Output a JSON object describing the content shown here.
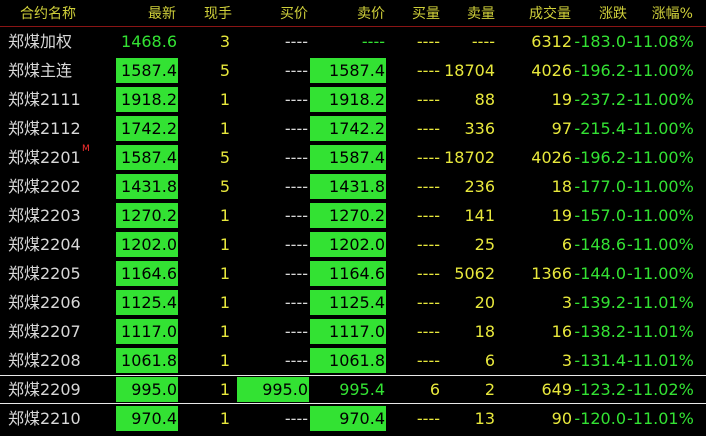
{
  "headers": {
    "name": "合约名称",
    "last": "最新",
    "cur_vol": "现手",
    "bid": "买价",
    "ask": "卖价",
    "bid_vol": "买量",
    "ask_vol": "卖量",
    "volume": "成交量",
    "change": "涨跌",
    "change_pct": "涨幅%"
  },
  "rows": [
    {
      "name": "郑煤加权",
      "mark": "",
      "last": "1468.6",
      "cur_vol": "3",
      "bid": "----",
      "ask": "----",
      "bid_vol": "----",
      "ask_vol": "----",
      "volume": "6312",
      "change": "-183.0",
      "change_pct": "-11.08%",
      "last_box": false,
      "bid_box": false,
      "ask_box": false,
      "selected": false
    },
    {
      "name": "郑煤主连",
      "mark": "",
      "last": "1587.4",
      "cur_vol": "5",
      "bid": "----",
      "ask": "1587.4",
      "bid_vol": "----",
      "ask_vol": "18704",
      "volume": "4026",
      "change": "-196.2",
      "change_pct": "-11.00%",
      "last_box": true,
      "bid_box": false,
      "ask_box": true,
      "selected": false
    },
    {
      "name": "郑煤2111",
      "mark": "",
      "last": "1918.2",
      "cur_vol": "1",
      "bid": "----",
      "ask": "1918.2",
      "bid_vol": "----",
      "ask_vol": "88",
      "volume": "19",
      "change": "-237.2",
      "change_pct": "-11.00%",
      "last_box": true,
      "bid_box": false,
      "ask_box": true,
      "selected": false
    },
    {
      "name": "郑煤2112",
      "mark": "",
      "last": "1742.2",
      "cur_vol": "1",
      "bid": "----",
      "ask": "1742.2",
      "bid_vol": "----",
      "ask_vol": "336",
      "volume": "97",
      "change": "-215.4",
      "change_pct": "-11.00%",
      "last_box": true,
      "bid_box": false,
      "ask_box": true,
      "selected": false
    },
    {
      "name": "郑煤2201",
      "mark": "M",
      "last": "1587.4",
      "cur_vol": "5",
      "bid": "----",
      "ask": "1587.4",
      "bid_vol": "----",
      "ask_vol": "18702",
      "volume": "4026",
      "change": "-196.2",
      "change_pct": "-11.00%",
      "last_box": true,
      "bid_box": false,
      "ask_box": true,
      "selected": false
    },
    {
      "name": "郑煤2202",
      "mark": "",
      "last": "1431.8",
      "cur_vol": "5",
      "bid": "----",
      "ask": "1431.8",
      "bid_vol": "----",
      "ask_vol": "236",
      "volume": "18",
      "change": "-177.0",
      "change_pct": "-11.00%",
      "last_box": true,
      "bid_box": false,
      "ask_box": true,
      "selected": false
    },
    {
      "name": "郑煤2203",
      "mark": "",
      "last": "1270.2",
      "cur_vol": "1",
      "bid": "----",
      "ask": "1270.2",
      "bid_vol": "----",
      "ask_vol": "141",
      "volume": "19",
      "change": "-157.0",
      "change_pct": "-11.00%",
      "last_box": true,
      "bid_box": false,
      "ask_box": true,
      "selected": false
    },
    {
      "name": "郑煤2204",
      "mark": "",
      "last": "1202.0",
      "cur_vol": "1",
      "bid": "----",
      "ask": "1202.0",
      "bid_vol": "----",
      "ask_vol": "25",
      "volume": "6",
      "change": "-148.6",
      "change_pct": "-11.00%",
      "last_box": true,
      "bid_box": false,
      "ask_box": true,
      "selected": false
    },
    {
      "name": "郑煤2205",
      "mark": "",
      "last": "1164.6",
      "cur_vol": "1",
      "bid": "----",
      "ask": "1164.6",
      "bid_vol": "----",
      "ask_vol": "5062",
      "volume": "1366",
      "change": "-144.0",
      "change_pct": "-11.00%",
      "last_box": true,
      "bid_box": false,
      "ask_box": true,
      "selected": false
    },
    {
      "name": "郑煤2206",
      "mark": "",
      "last": "1125.4",
      "cur_vol": "1",
      "bid": "----",
      "ask": "1125.4",
      "bid_vol": "----",
      "ask_vol": "20",
      "volume": "3",
      "change": "-139.2",
      "change_pct": "-11.01%",
      "last_box": true,
      "bid_box": false,
      "ask_box": true,
      "selected": false
    },
    {
      "name": "郑煤2207",
      "mark": "",
      "last": "1117.0",
      "cur_vol": "1",
      "bid": "----",
      "ask": "1117.0",
      "bid_vol": "----",
      "ask_vol": "18",
      "volume": "16",
      "change": "-138.2",
      "change_pct": "-11.01%",
      "last_box": true,
      "bid_box": false,
      "ask_box": true,
      "selected": false
    },
    {
      "name": "郑煤2208",
      "mark": "",
      "last": "1061.8",
      "cur_vol": "1",
      "bid": "----",
      "ask": "1061.8",
      "bid_vol": "----",
      "ask_vol": "6",
      "volume": "3",
      "change": "-131.4",
      "change_pct": "-11.01%",
      "last_box": true,
      "bid_box": false,
      "ask_box": true,
      "selected": false
    },
    {
      "name": "郑煤2209",
      "mark": "",
      "last": "995.0",
      "cur_vol": "1",
      "bid": "995.0",
      "ask": "995.4",
      "bid_vol": "6",
      "ask_vol": "2",
      "volume": "649",
      "change": "-123.2",
      "change_pct": "-11.02%",
      "last_box": true,
      "bid_box": true,
      "ask_box": false,
      "selected": true
    },
    {
      "name": "郑煤2210",
      "mark": "",
      "last": "970.4",
      "cur_vol": "1",
      "bid": "----",
      "ask": "970.4",
      "bid_vol": "----",
      "ask_vol": "13",
      "volume": "90",
      "change": "-120.0",
      "change_pct": "-11.01%",
      "last_box": true,
      "bid_box": false,
      "ask_box": true,
      "selected": false
    }
  ],
  "colors": {
    "up_box": "#33e233",
    "text_green": "#33e233",
    "text_yellow": "#e8e83c",
    "header": "#cfcf3a",
    "divider": "#8a1515"
  }
}
